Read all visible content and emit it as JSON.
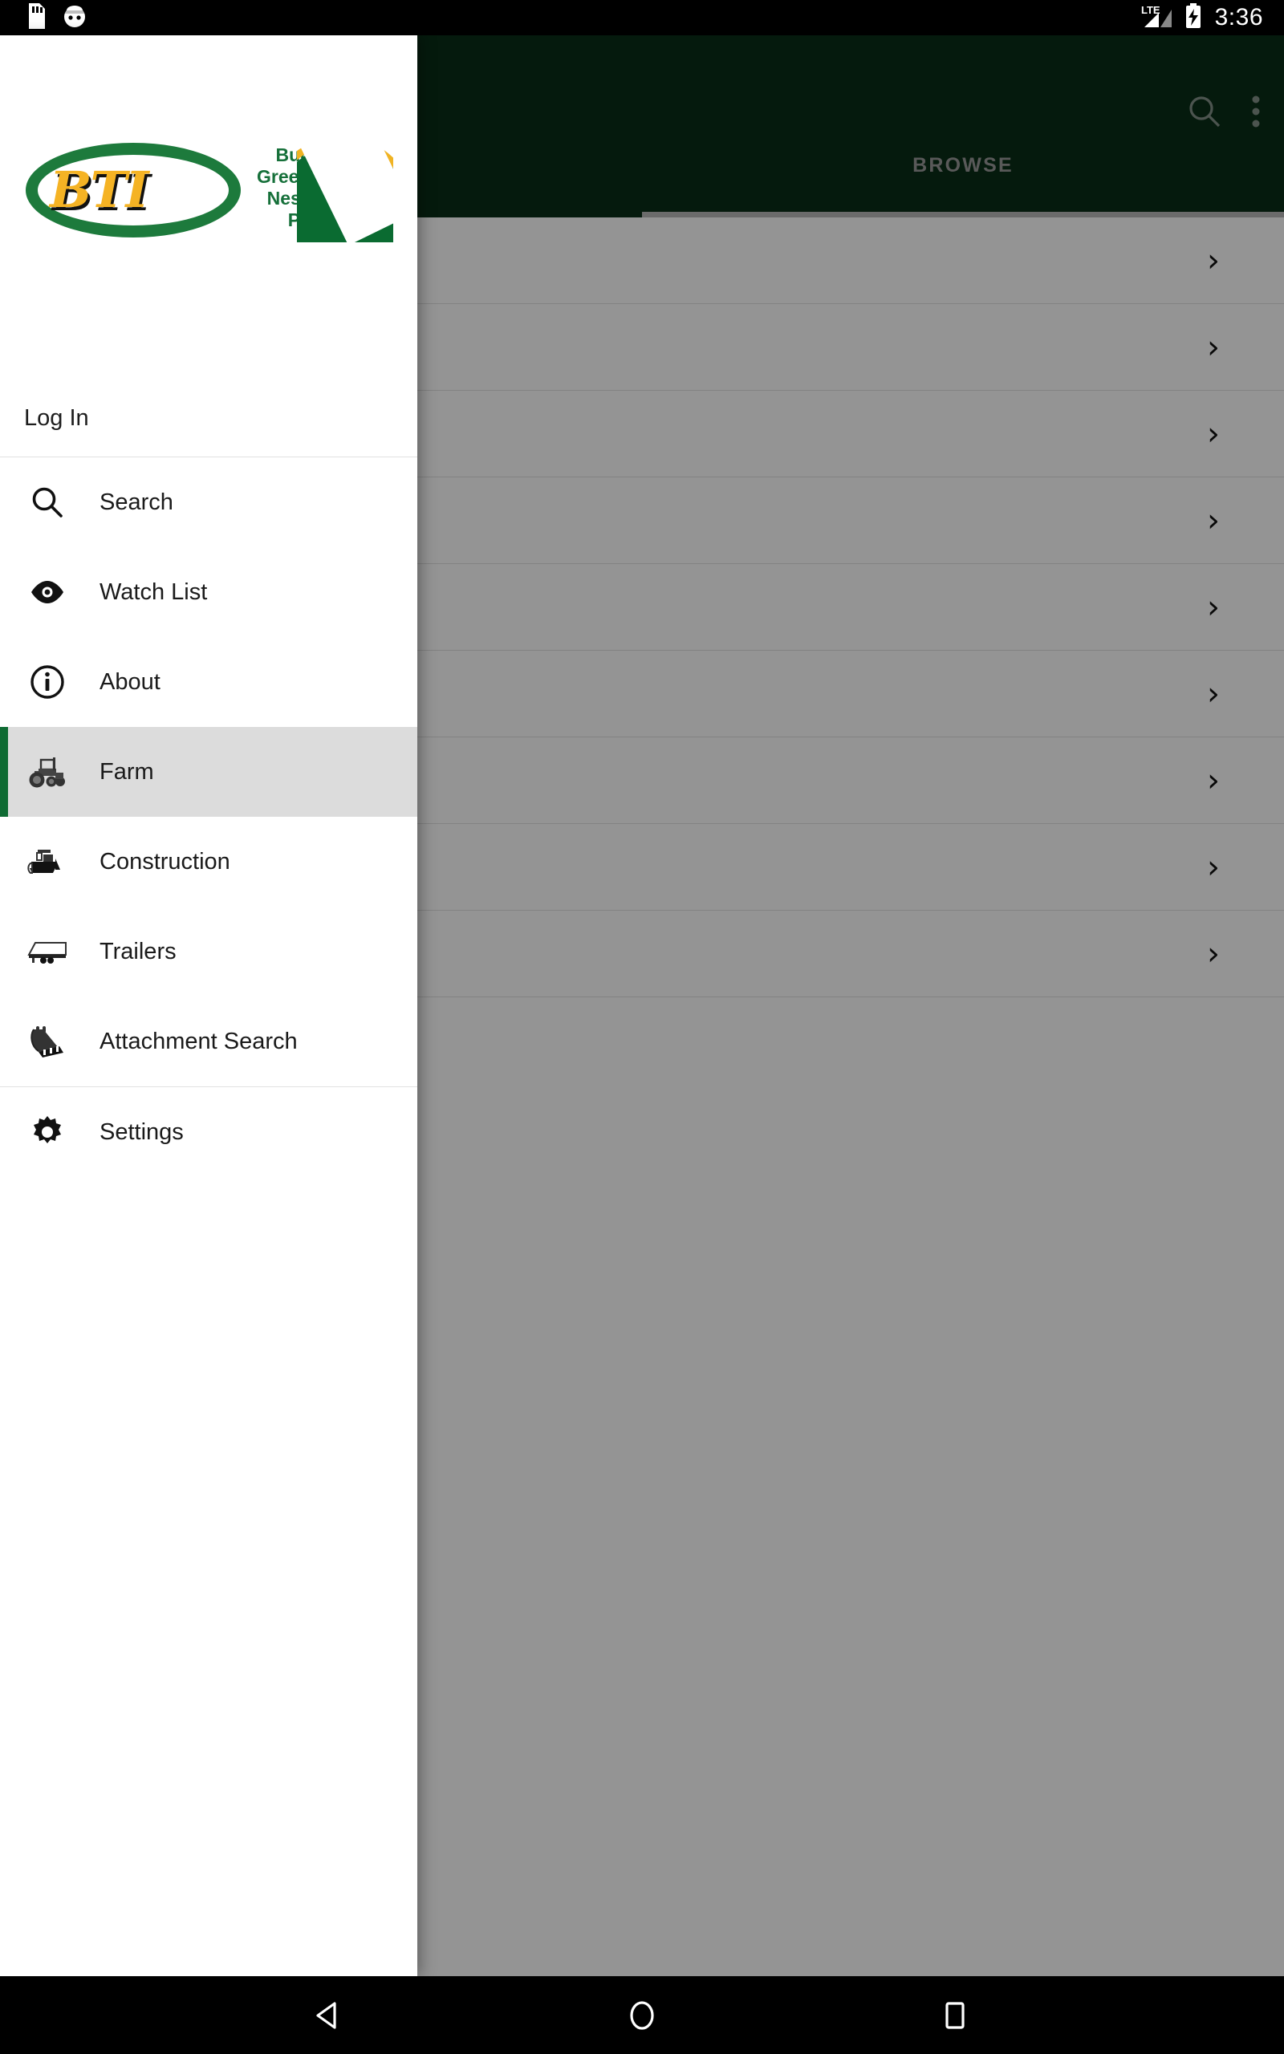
{
  "status_bar": {
    "icons_left": [
      "sd-card-icon",
      "android-head-icon"
    ],
    "network": "LTE",
    "battery": "charging",
    "time": "3:36"
  },
  "app_bar": {
    "search_icon": "search-icon",
    "overflow_icon": "more-vertical-icon",
    "background_color": "#0a2e17",
    "tabs": [
      {
        "label": "BROWSE",
        "selected": true
      }
    ]
  },
  "content": {
    "rows": [
      {
        "chevron": "›"
      },
      {
        "chevron": "›"
      },
      {
        "chevron": "›"
      },
      {
        "chevron": "›"
      },
      {
        "chevron": "›"
      },
      {
        "chevron": "›"
      },
      {
        "chevron": "›"
      },
      {
        "chevron": "›"
      },
      {
        "chevron": "›"
      }
    ]
  },
  "drawer": {
    "logo": {
      "monogram": "BTI",
      "cities": "Bucklin\nGreensburg\nNess City\nPratt",
      "green": "#16703a",
      "gold": "#f5b324"
    },
    "login": {
      "label": "Log In"
    },
    "items": [
      {
        "label": "Search",
        "icon": "search-icon",
        "selected": false
      },
      {
        "label": "Watch List",
        "icon": "eye-icon",
        "selected": false
      },
      {
        "label": "About",
        "icon": "info-circle-icon",
        "selected": false
      },
      {
        "label": "Farm",
        "icon": "tractor-icon",
        "selected": true
      },
      {
        "label": "Construction",
        "icon": "bulldozer-icon",
        "selected": false
      },
      {
        "label": "Trailers",
        "icon": "trailer-icon",
        "selected": false
      },
      {
        "label": "Attachment Search",
        "icon": "excavator-bucket-icon",
        "selected": false
      }
    ],
    "settings": {
      "label": "Settings",
      "icon": "gear-icon"
    },
    "accent_color": "#0f6b33",
    "selected_row_color": "#dcdcdc"
  },
  "nav_bar": {
    "back": "back-triangle-icon",
    "home": "home-circle-icon",
    "recents": "recents-square-icon"
  }
}
